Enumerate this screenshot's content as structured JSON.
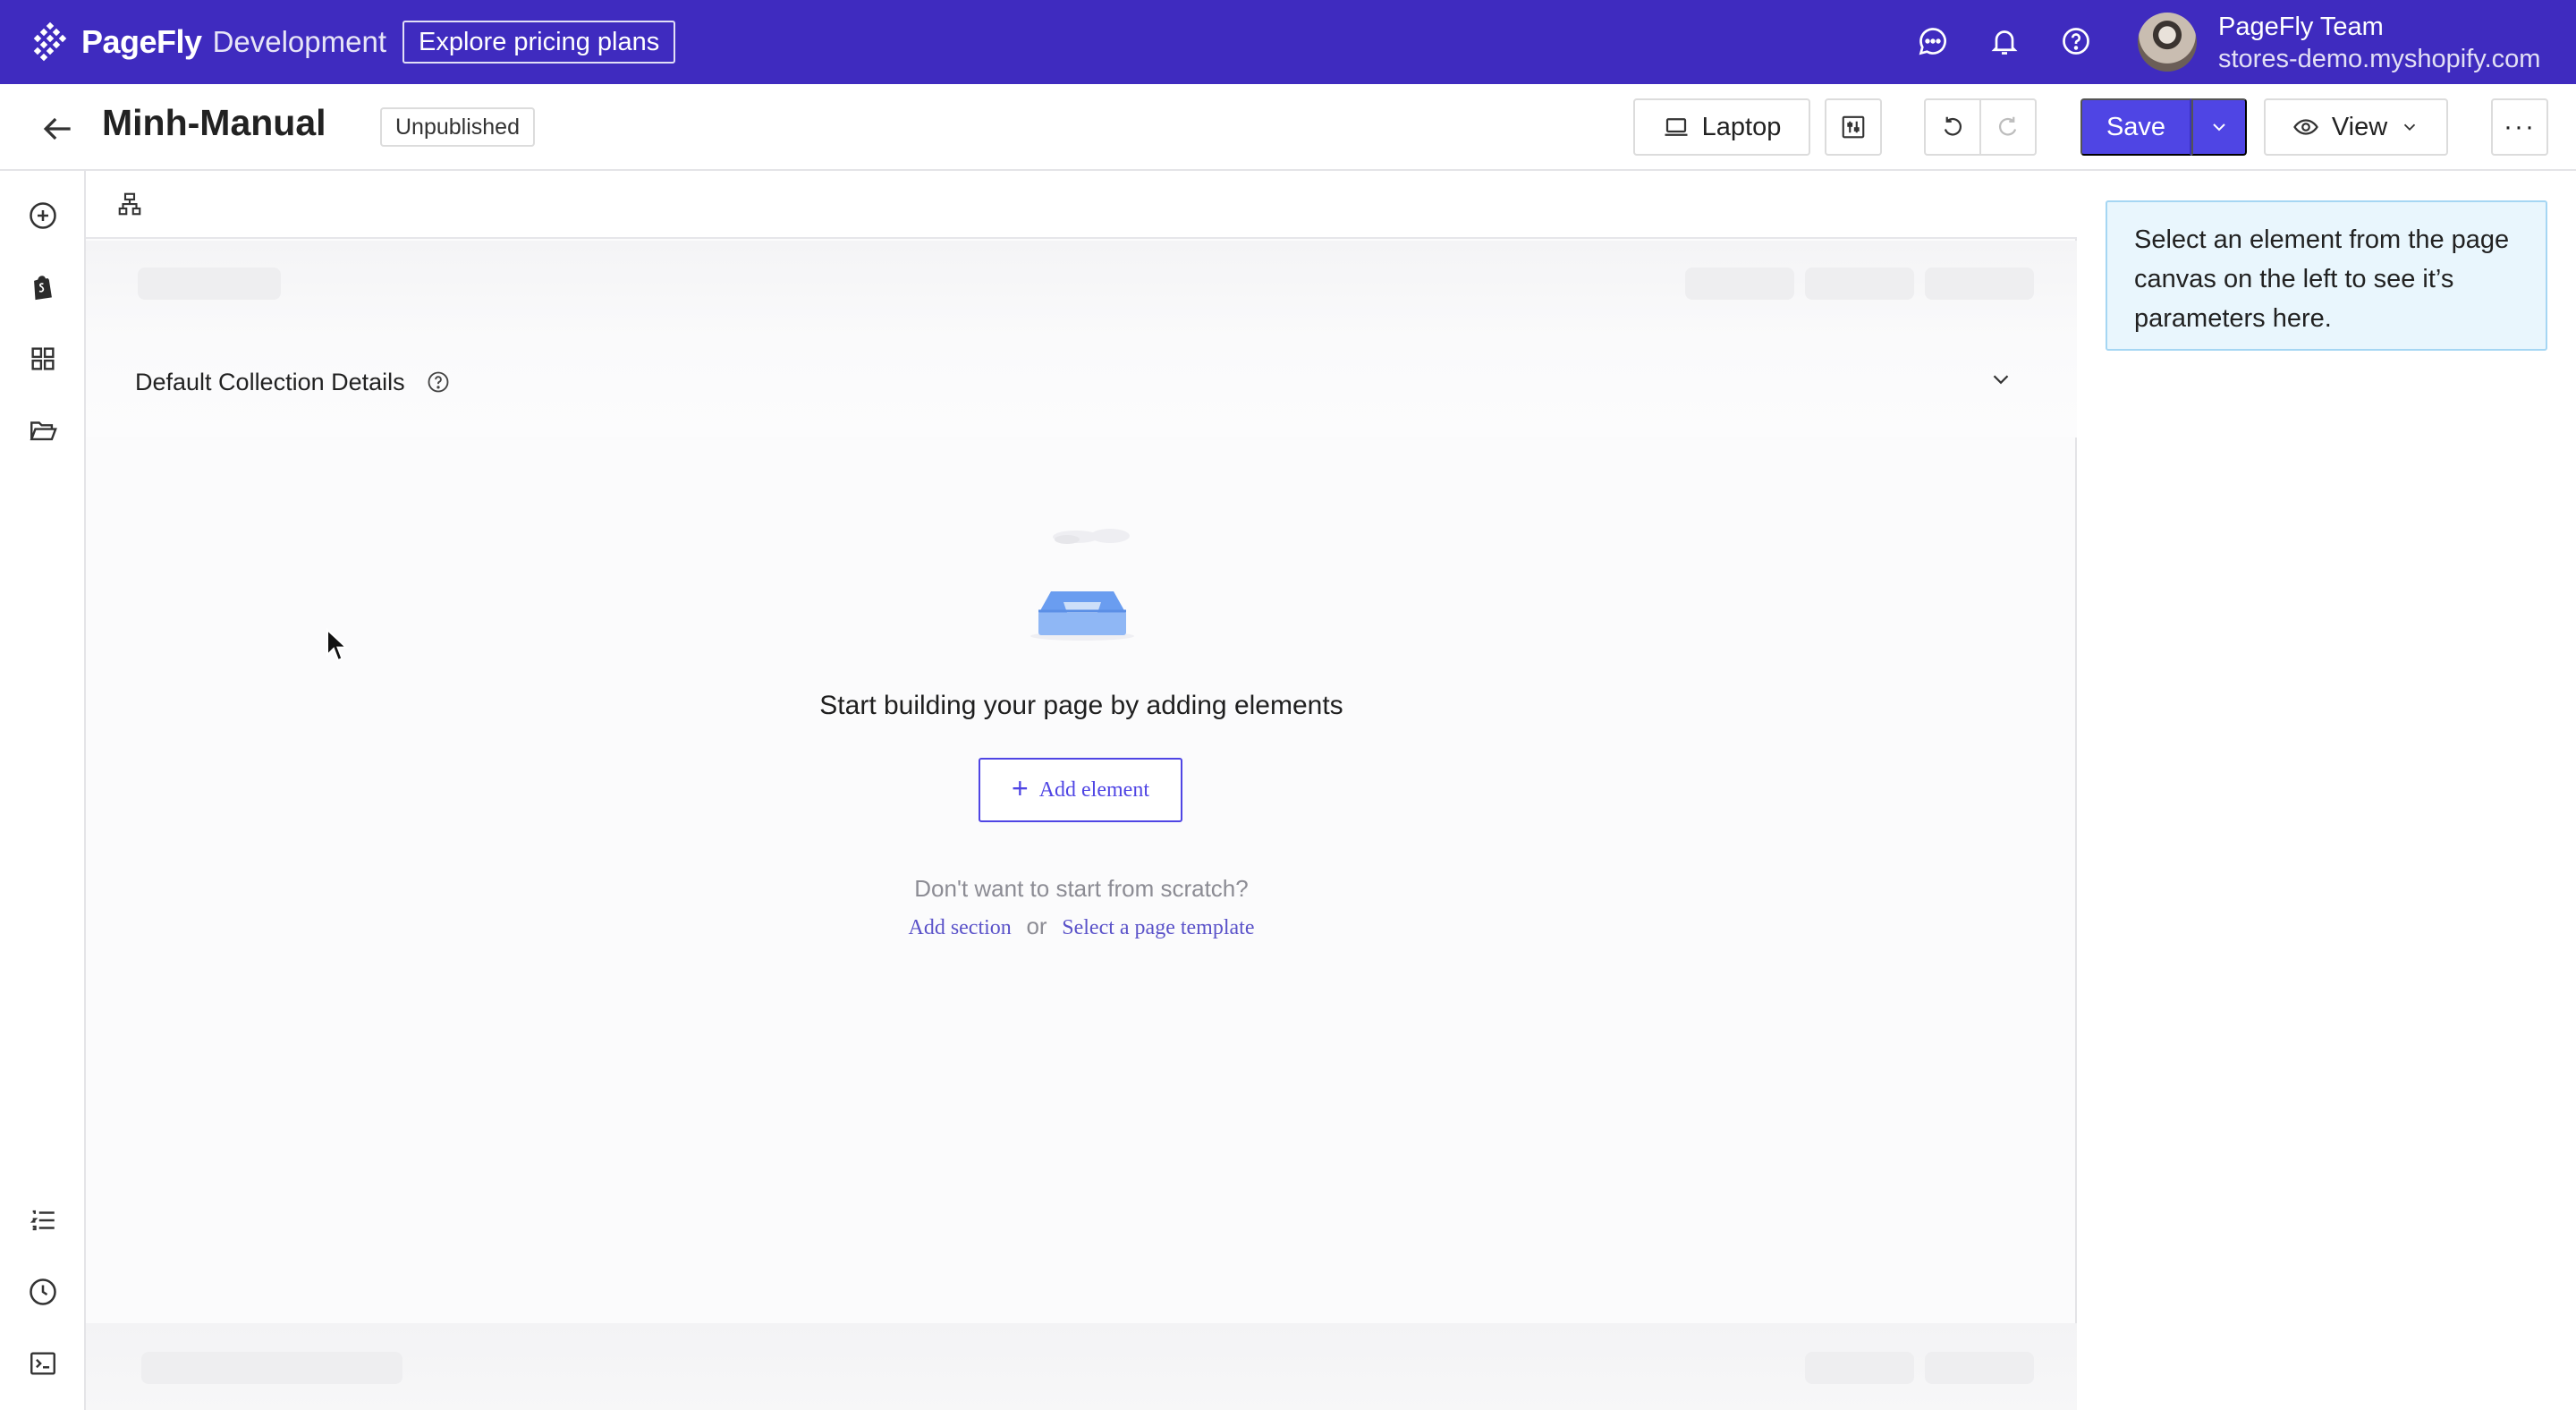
{
  "topbar": {
    "brand": "PageFly",
    "environment": "Development",
    "pricing_button": "Explore pricing plans",
    "account_name": "PageFly Team",
    "store_domain": "stores-demo.myshopify.com",
    "icons": [
      "chat-icon",
      "bell-icon",
      "help-icon"
    ],
    "background_color": "#3f2bbf"
  },
  "header": {
    "page_title": "Minh-Manual",
    "status": "Unpublished",
    "device_label": "Laptop",
    "save_label": "Save",
    "view_label": "View",
    "more_label": "···",
    "accent_color": "#4f45e4"
  },
  "left_rail": {
    "top_icons": [
      "add-element-icon",
      "shopify-icon",
      "grid-icon",
      "folder-icon"
    ],
    "bottom_icons": [
      "list-icon",
      "history-icon",
      "terminal-icon"
    ]
  },
  "canvas": {
    "collection_title": "Default Collection Details",
    "empty_title": "Start building your page by adding elements",
    "add_element_label": "Add element",
    "add_element_plus": "+",
    "scratch_text": "Don't want to start from scratch?",
    "add_section_link": "Add section",
    "or_text": "or",
    "template_link": "Select a page template"
  },
  "right_panel": {
    "info_text": "Select an element from the page canvas on the left to see it’s parameters here."
  }
}
